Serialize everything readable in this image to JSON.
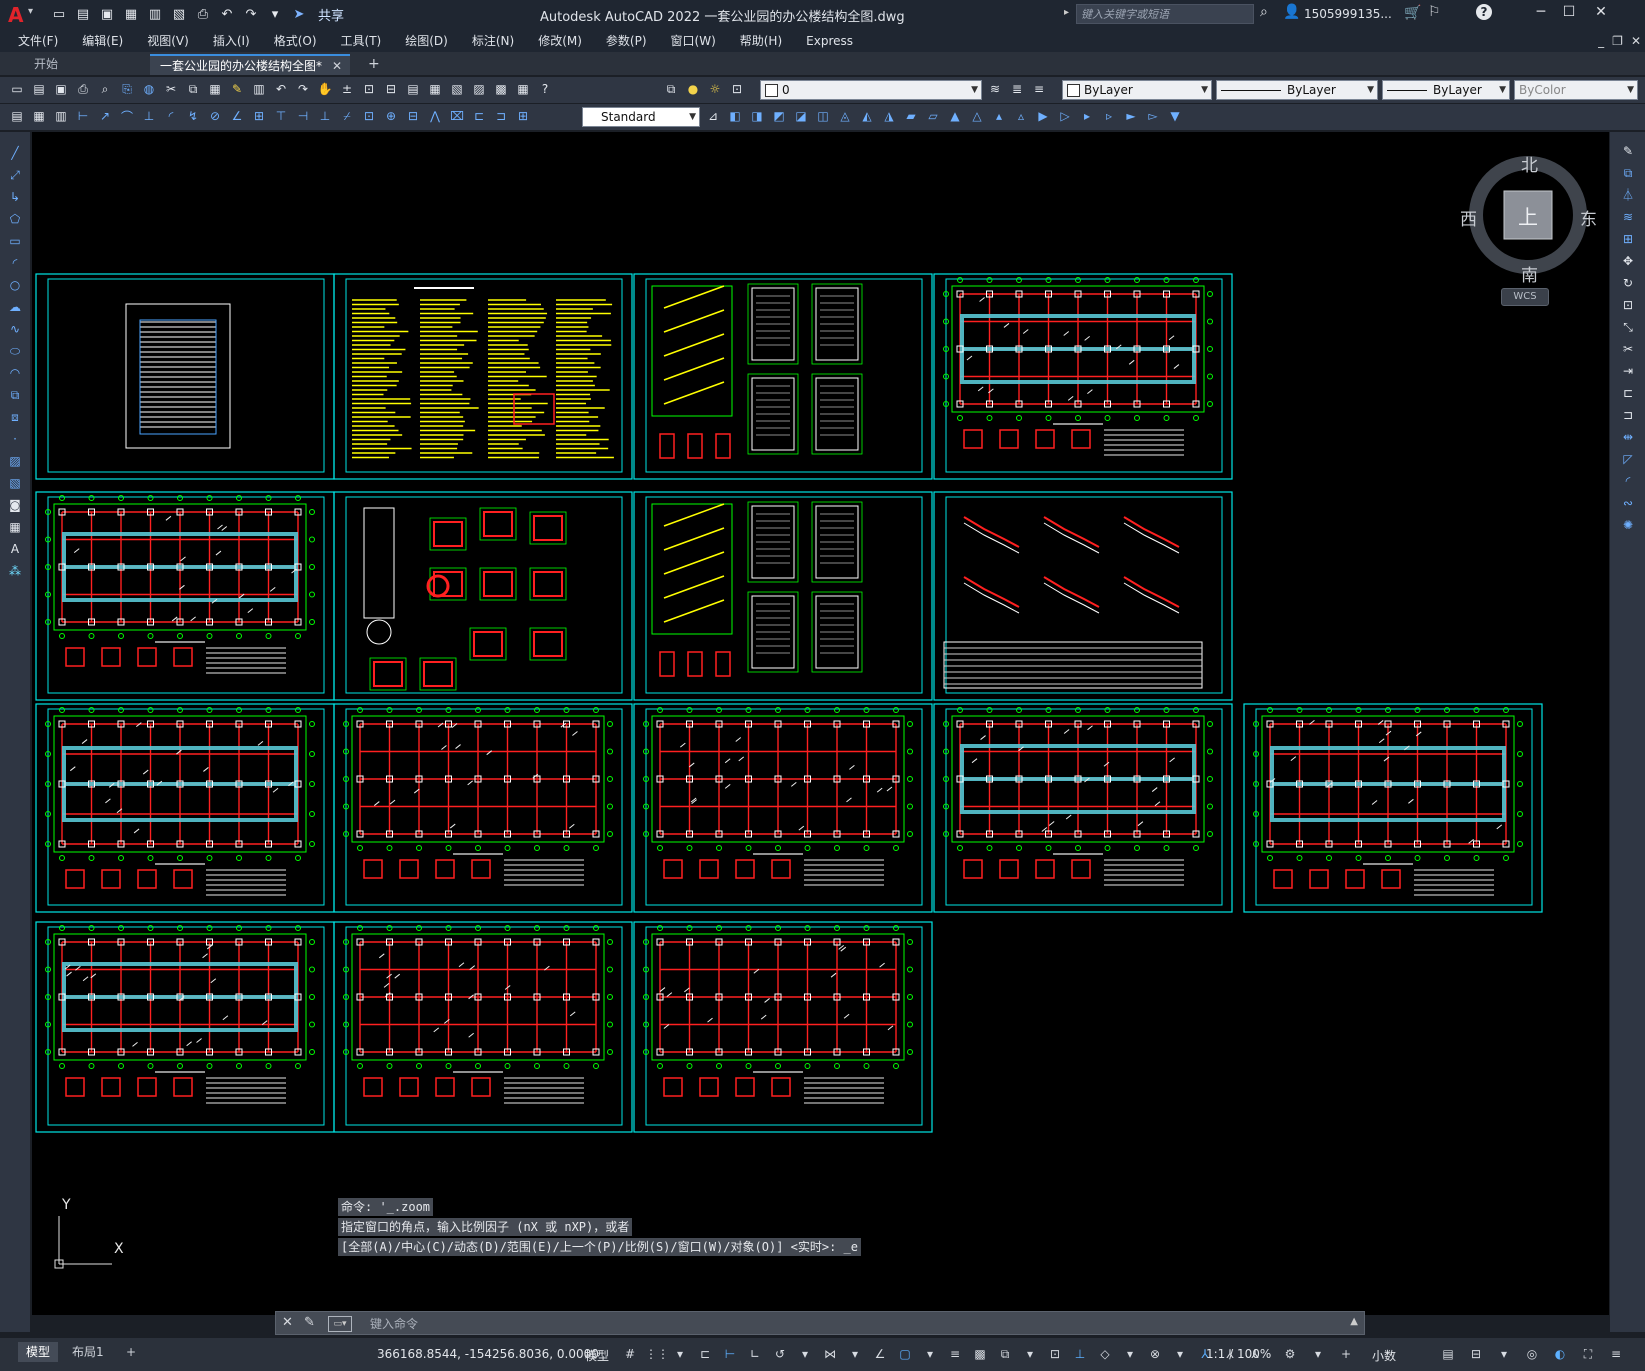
{
  "titlebar": {
    "logo": "A",
    "share_label": "共享",
    "title": "Autodesk AutoCAD 2022    一套公业园的办公楼结构全图.dwg",
    "search_placeholder": "键入关键字或短语",
    "user_name": "1505999135...",
    "quick_access_icons": [
      "new-icon",
      "open-icon",
      "save-icon",
      "saveas-icon",
      "web-open-icon",
      "web-save-icon",
      "plot-icon",
      "undo-icon",
      "redo-icon",
      "customize-icon"
    ]
  },
  "menu": {
    "items": [
      "文件(F)",
      "编辑(E)",
      "视图(V)",
      "插入(I)",
      "格式(O)",
      "工具(T)",
      "绘图(D)",
      "标注(N)",
      "修改(M)",
      "参数(P)",
      "窗口(W)",
      "帮助(H)",
      "Express"
    ]
  },
  "tabs": {
    "start": "开始",
    "drawing": "一套公业园的办公楼结构全图*",
    "close": "✕",
    "new": "+"
  },
  "toolbar": {
    "layer_value": "0",
    "text_style": "Standard",
    "color_value": "ByLayer",
    "linetype_value": "ByLayer",
    "lineweight_value": "ByLayer",
    "plotstyle_value": "ByColor"
  },
  "viewcube": {
    "north": "北",
    "south": "南",
    "east": "东",
    "west": "西",
    "face": "上",
    "wcs": "WCS"
  },
  "ucs": {
    "x": "X",
    "y": "Y"
  },
  "command_history": [
    "命令: '_.zoom",
    "指定窗口的角点，输入比例因子 (nX 或 nXP)，或者",
    "[全部(A)/中心(C)/动态(D)/范围(E)/上一个(P)/比例(S)/窗口(W)/对象(O)] <实时>: _e"
  ],
  "command_placeholder": "键入命令",
  "status": {
    "model_tab": "模型",
    "layout_tab": "布局1",
    "add_tab": "+",
    "coordinates": "366168.8544, -154256.8036, 0.0000",
    "space": "模型",
    "scale": "1:1 / 100%",
    "units": "小数"
  },
  "colors": {
    "frame": "#00e5e5",
    "canvas": "#000000",
    "grid_red": "#ff2020",
    "dim_green": "#00ff00",
    "text_yellow": "#ffff00",
    "title_bar": "#1f2631",
    "toolbar": "#2f3643",
    "accent_blue": "#3a8dde"
  }
}
